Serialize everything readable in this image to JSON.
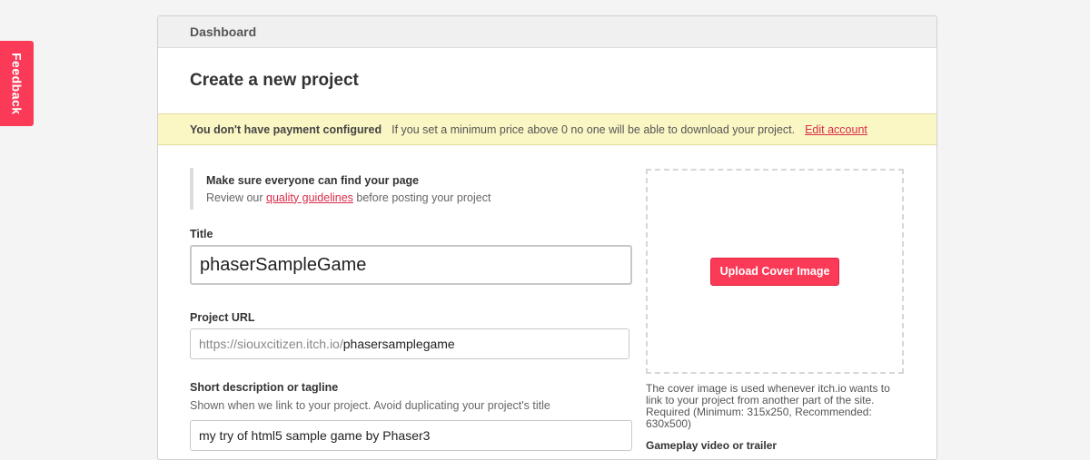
{
  "feedback": {
    "label": "Feedback"
  },
  "header": {
    "title": "Dashboard"
  },
  "page": {
    "title": "Create a new project"
  },
  "notice": {
    "strong": "You don't have payment configured",
    "message": "If you set a minimum price above 0 no one will be able to download your project.",
    "link": "Edit account"
  },
  "guide": {
    "title": "Make sure everyone can find your page",
    "prefix": "Review our",
    "link": "quality guidelines",
    "suffix": "before posting your project"
  },
  "fields": {
    "title": {
      "label": "Title",
      "value": "phaserSampleGame"
    },
    "url": {
      "label": "Project URL",
      "prefix": "https://siouxcitizen.itch.io/",
      "value": "phasersamplegame"
    },
    "description": {
      "label": "Short description or tagline",
      "hint": "Shown when we link to your project. Avoid duplicating your project's title",
      "value": "my try of html5 sample game by Phaser3"
    }
  },
  "cover": {
    "button": "Upload Cover Image",
    "note": "The cover image is used whenever itch.io wants to link to your project from another part of the site. Required (Minimum: 315x250, Recommended: 630x500)"
  },
  "video": {
    "label": "Gameplay video or trailer"
  },
  "colors": {
    "accent": "#fa3a57",
    "notice_bg": "#fbf7c5",
    "link": "#da2c49"
  }
}
